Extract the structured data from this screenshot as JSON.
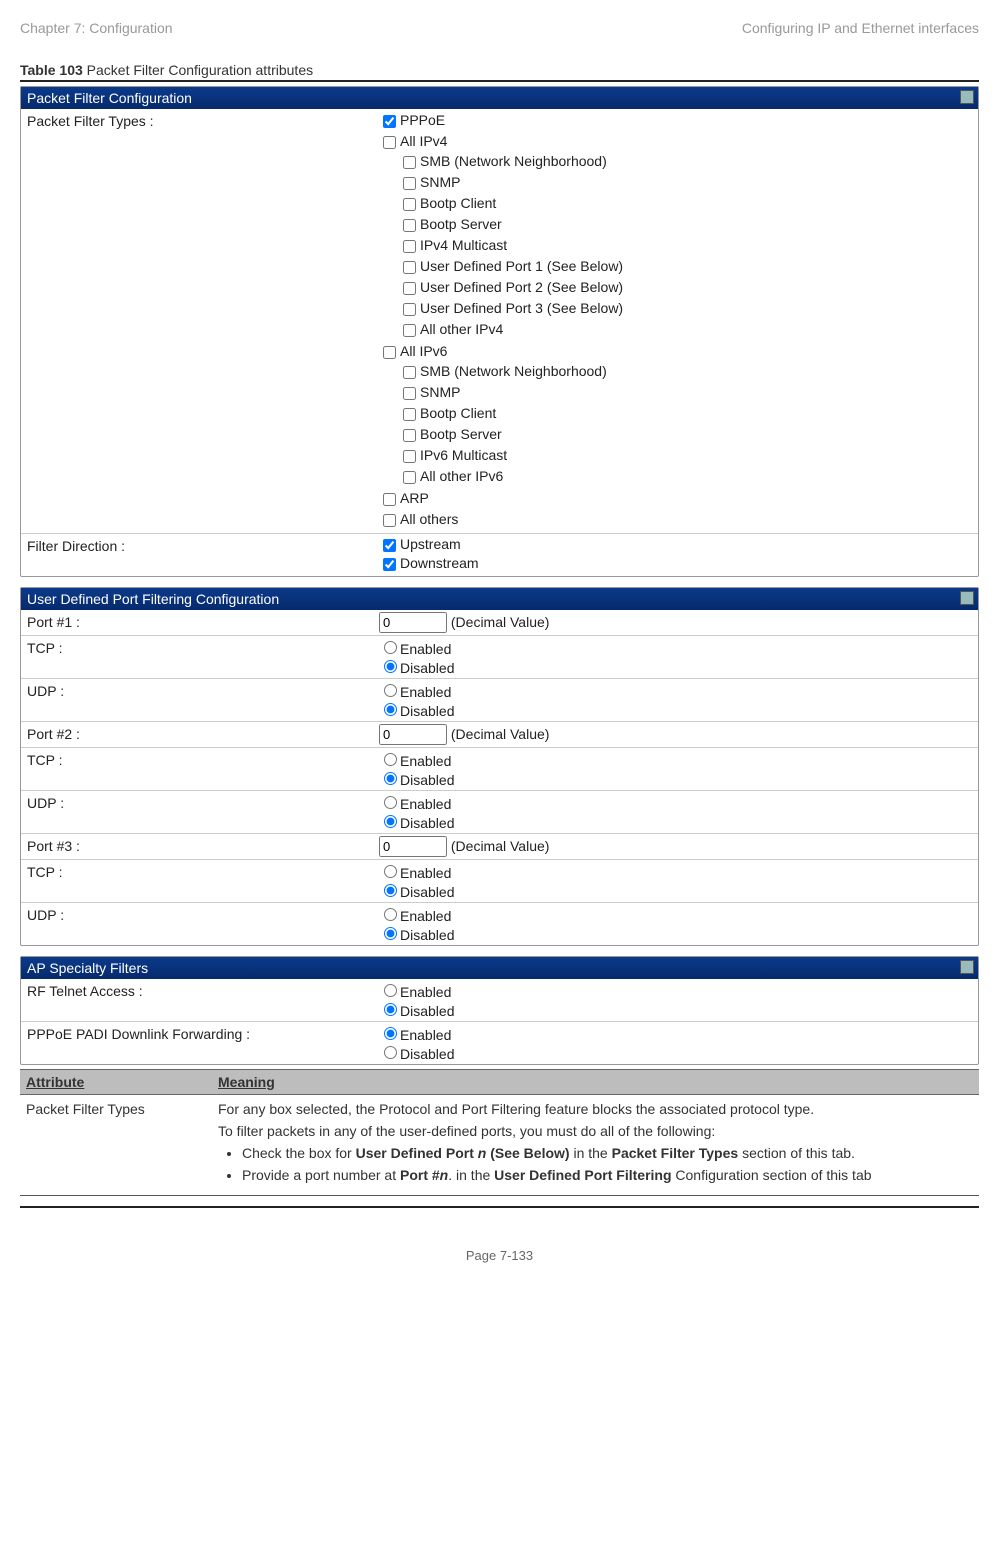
{
  "header": {
    "left": "Chapter 7:  Configuration",
    "right": "Configuring IP and Ethernet interfaces"
  },
  "tableTitle": {
    "bold": "Table 103",
    "rest": " Packet Filter Configuration attributes"
  },
  "panel1": {
    "title": "Packet Filter Configuration",
    "row1Label": "Packet Filter Types :",
    "row2Label": "Filter Direction :",
    "tree": {
      "pppoe": "PPPoE",
      "allipv4": "All IPv4",
      "v4": {
        "smb": "SMB (Network Neighborhood)",
        "snmp": "SNMP",
        "bootpc": "Bootp Client",
        "bootps": "Bootp Server",
        "mcast": "IPv4 Multicast",
        "udp1": "User Defined Port 1 (See Below)",
        "udp2": "User Defined Port 2 (See Below)",
        "udp3": "User Defined Port 3 (See Below)",
        "other": "All other IPv4"
      },
      "allipv6": "All IPv6",
      "v6": {
        "smb": "SMB (Network Neighborhood)",
        "snmp": "SNMP",
        "bootpc": "Bootp Client",
        "bootps": "Bootp Server",
        "mcast": "IPv6 Multicast",
        "other": "All other IPv6"
      },
      "arp": "ARP",
      "allothers": "All others"
    },
    "dir": {
      "up": "Upstream",
      "down": "Downstream"
    }
  },
  "panel2": {
    "title": "User Defined Port Filtering Configuration",
    "decimal": "(Decimal Value)",
    "enabled": "Enabled",
    "disabled": "Disabled",
    "rows": {
      "p1": "Port #1 :",
      "p2": "Port #2 :",
      "p3": "Port #3 :",
      "tcp": "TCP :",
      "udp": "UDP :",
      "val": "0"
    }
  },
  "panel3": {
    "title": "AP Specialty Filters",
    "rf": "RF Telnet Access :",
    "padi": "PPPoE PADI Downlink Forwarding :",
    "enabled": "Enabled",
    "disabled": "Disabled"
  },
  "attrTable": {
    "h1": "Attribute",
    "h2": "Meaning",
    "r1c1": "Packet Filter Types",
    "r1c2a": "For any box selected, the Protocol and Port Filtering feature blocks the associated protocol type.",
    "r1c2b": "To filter packets in any of the user-defined ports, you must do all of the following:",
    "b1a": "Check the box for ",
    "b1b": "User Defined Port ",
    "b1i": "n",
    "b1c": " (See Below)",
    "b1d": " in the ",
    "b1e": "Packet Filter Types",
    "b1f": " section of this tab.",
    "b2a": "Provide a port number at ",
    "b2b": "Port #",
    "b2i": "n",
    "b2c": ". in the ",
    "b2d": "User Defined Port Filtering",
    "b2e": " Configuration section of this tab"
  },
  "footer": "Page 7-133"
}
